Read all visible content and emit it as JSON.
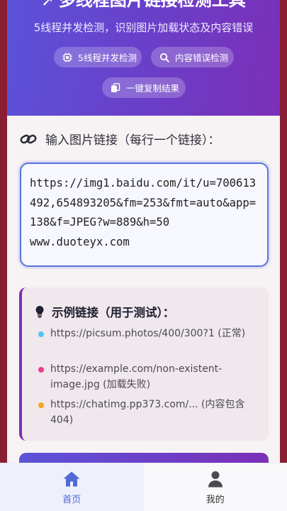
{
  "header": {
    "title": "多线程图片链接检测工具",
    "subtitle": "5线程并发检测，识别图片加载状态及内容错误",
    "features": [
      {
        "icon": "chip-icon",
        "label": "5线程并发检测"
      },
      {
        "icon": "search-icon",
        "label": "内容错误检测"
      },
      {
        "icon": "copy-icon",
        "label": "一键复制结果"
      }
    ]
  },
  "input": {
    "label": "输入图片链接（每行一个链接）：",
    "value": "https://img1.baidu.com/it/u=700613492,654893205&fm=253&fmt=auto&app=138&f=JPEG?w=889&h=50\nwww.duoteyx.com"
  },
  "examples": {
    "title": "示例链接（用于测试）：",
    "items": [
      {
        "text": "https://picsum.photos/400/300?1 (正常)",
        "color": "#4fc3f7"
      },
      {
        "text": "https://example.com/non-existent-image.jpg (加载失败)",
        "color": "#e83e8c"
      },
      {
        "text": "https://chatimg.pp373.com/... (内容包含404)",
        "color": "#f5a623"
      }
    ]
  },
  "tabs": [
    {
      "label": "首页",
      "icon": "home-icon",
      "active": true
    },
    {
      "label": "我的",
      "icon": "user-icon",
      "active": false
    }
  ],
  "colors": {
    "accent": "#5269d6",
    "header_start": "#5b53d9",
    "header_end": "#7b2fb8"
  }
}
